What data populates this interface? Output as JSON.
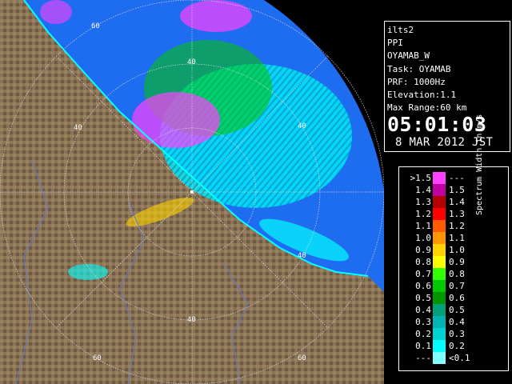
{
  "radar": {
    "range_labels": [
      "60",
      "40",
      "40",
      "40",
      "40",
      "40",
      "60",
      "60"
    ],
    "colors": {
      "sea": "#1e6cf0",
      "land": "#8a7356",
      "land_light": "#a89070",
      "rings": "#d8d8d8",
      "rivers": "#6a78c8",
      "borders": "#b46464"
    }
  },
  "info": {
    "site": "ilts2",
    "mode": "PPI",
    "name": "OYAMAB_W",
    "task": "Task: OYAMAB",
    "prf": "PRF: 1000Hz",
    "elevation": "Elevation:1.1",
    "max_range": "Max Range:60 km",
    "time": "05:01:03",
    "date": "8 MAR 2012 JST"
  },
  "legend": {
    "title": "Spectrum Width in m/s",
    "rows": [
      {
        "lo": ">1.5",
        "hi": "---",
        "color": "#ff40ff"
      },
      {
        "lo": "1.4",
        "hi": "1.5",
        "color": "#c000a0"
      },
      {
        "lo": "1.3",
        "hi": "1.4",
        "color": "#b40000"
      },
      {
        "lo": "1.2",
        "hi": "1.3",
        "color": "#ff0000"
      },
      {
        "lo": "1.1",
        "hi": "1.2",
        "color": "#ff5a00"
      },
      {
        "lo": "1.0",
        "hi": "1.1",
        "color": "#ff9600"
      },
      {
        "lo": "0.9",
        "hi": "1.0",
        "color": "#ffd200"
      },
      {
        "lo": "0.8",
        "hi": "0.9",
        "color": "#ffff00"
      },
      {
        "lo": "0.7",
        "hi": "0.8",
        "color": "#32ff00"
      },
      {
        "lo": "0.6",
        "hi": "0.7",
        "color": "#00c800"
      },
      {
        "lo": "0.5",
        "hi": "0.6",
        "color": "#009600"
      },
      {
        "lo": "0.4",
        "hi": "0.5",
        "color": "#00a078"
      },
      {
        "lo": "0.3",
        "hi": "0.4",
        "color": "#00b4b4"
      },
      {
        "lo": "0.2",
        "hi": "0.3",
        "color": "#00d2d2"
      },
      {
        "lo": "0.1",
        "hi": "0.2",
        "color": "#00ffff"
      },
      {
        "lo": "---",
        "hi": "<0.1",
        "color": "#80ffff"
      }
    ]
  }
}
